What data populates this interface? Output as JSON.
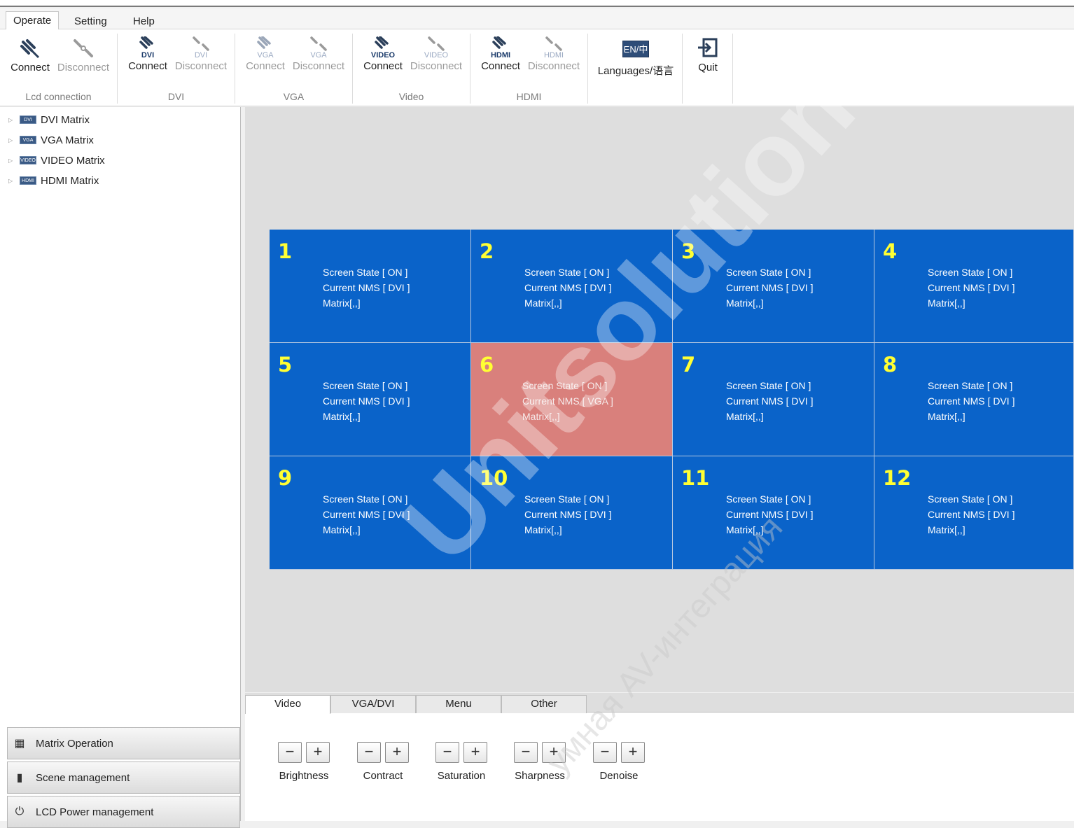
{
  "menu": [
    "Operate",
    "Setting",
    "Help"
  ],
  "ribbon": {
    "groups": [
      {
        "label": "Lcd connection",
        "connect": "Connect",
        "disconnect": "Disconnect",
        "tag": ""
      },
      {
        "label": "DVI",
        "connect": "Connect",
        "disconnect": "Disconnect",
        "tag": "DVI"
      },
      {
        "label": "VGA",
        "connect": "Connect",
        "disconnect": "Disconnect",
        "tag": "VGA"
      },
      {
        "label": "Video",
        "connect": "Connect",
        "disconnect": "Disconnect",
        "tag": "VIDEO"
      },
      {
        "label": "HDMI",
        "connect": "Connect",
        "disconnect": "Disconnect",
        "tag": "HDMI"
      }
    ],
    "languages": "Languages/语言",
    "languages_icon": "EN/中",
    "quit": "Quit"
  },
  "tree": [
    {
      "badge": "DVI",
      "label": "DVI Matrix"
    },
    {
      "badge": "VGA",
      "label": "VGA Matrix"
    },
    {
      "badge": "VIDEO",
      "label": "VIDEO Matrix"
    },
    {
      "badge": "HDMI",
      "label": "HDMI Matrix"
    }
  ],
  "nav": [
    "Matrix Operation",
    "Scene management",
    "LCD Power management"
  ],
  "screens": [
    {
      "num": "1",
      "state": "Screen State [ ON ]",
      "nms": "Current NMS [ DVI ]",
      "matrix": "Matrix[,,]"
    },
    {
      "num": "2",
      "state": "Screen State [ ON ]",
      "nms": "Current NMS [ DVI ]",
      "matrix": "Matrix[,,]"
    },
    {
      "num": "3",
      "state": "Screen State [ ON ]",
      "nms": "Current NMS [ DVI ]",
      "matrix": "Matrix[,,]"
    },
    {
      "num": "4",
      "state": "Screen State [ ON ]",
      "nms": "Current NMS [ DVI ]",
      "matrix": "Matrix[,,]"
    },
    {
      "num": "5",
      "state": "Screen State [ ON ]",
      "nms": "Current NMS [ DVI ]",
      "matrix": "Matrix[,,]"
    },
    {
      "num": "6",
      "state": "Screen State [ ON ]",
      "nms": "Current NMS [ VGA ]",
      "matrix": "Matrix[,,]"
    },
    {
      "num": "7",
      "state": "Screen State [ ON ]",
      "nms": "Current NMS [ DVI ]",
      "matrix": "Matrix[,,]"
    },
    {
      "num": "8",
      "state": "Screen State [ ON ]",
      "nms": "Current NMS [ DVI ]",
      "matrix": "Matrix[,,]"
    },
    {
      "num": "9",
      "state": "Screen State [ ON ]",
      "nms": "Current NMS [ DVI ]",
      "matrix": "Matrix[,,]"
    },
    {
      "num": "10",
      "state": "Screen State [ ON ]",
      "nms": "Current NMS [ DVI ]",
      "matrix": "Matrix[,,]"
    },
    {
      "num": "11",
      "state": "Screen State [ ON ]",
      "nms": "Current NMS [ DVI ]",
      "matrix": "Matrix[,,]"
    },
    {
      "num": "12",
      "state": "Screen State [ ON ]",
      "nms": "Current NMS [ DVI ]",
      "matrix": "Matrix[,,]"
    }
  ],
  "tabs": [
    "Video",
    "VGA/DVI",
    "Menu",
    "Other"
  ],
  "adjust": [
    "Brightness",
    "Contract",
    "Saturation",
    "Sharpness",
    "Denoise"
  ],
  "adjust_symbols": {
    "minus": "−",
    "plus": "+"
  },
  "watermark": {
    "main": "Unitsolutions",
    "sub": "умная AV-интеграция"
  },
  "colors": {
    "screen_blue": "#0a63c9",
    "screen_selected": "#d9807c",
    "screen_number": "#ffff33"
  }
}
